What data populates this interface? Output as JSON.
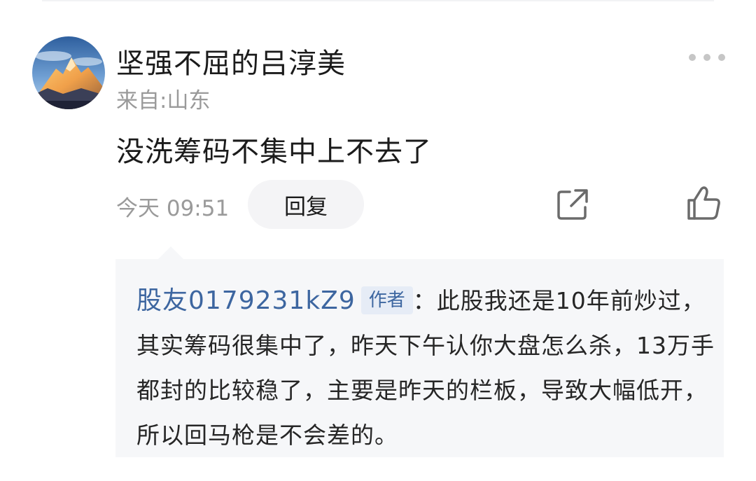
{
  "comment": {
    "username": "坚强不屈的吕淳美",
    "location": "来自:山东",
    "text": "没洗筹码不集中上不去了",
    "timestamp": "今天 09:51",
    "reply_label": "回复"
  },
  "quote": {
    "author": "股友0179231kZ9",
    "badge": "作者",
    "separator": "：",
    "text": "此股我还是10年前炒过，其实筹码很集中了，昨天下午认你大盘怎么杀，13万手都封的比较稳了，主要是昨天的栏板，导致大幅低开，所以回马枪是不会差的。"
  },
  "icons": {
    "avatar": "mountain-sunset-avatar",
    "more": "more-dots-icon",
    "share": "share-icon",
    "like": "thumbs-up-icon"
  },
  "colors": {
    "author_blue": "#3d66a0",
    "badge_bg": "#e6ecf6",
    "quote_bg": "#f6f7f9",
    "muted_text": "#9a9a9a"
  }
}
